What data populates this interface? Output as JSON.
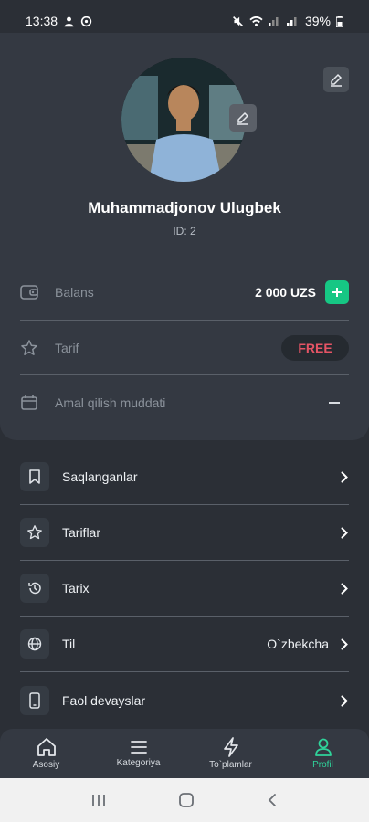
{
  "status_bar": {
    "time": "13:38",
    "battery": "39%"
  },
  "profile": {
    "name": "Muhammadjonov Ulugbek",
    "id_text": "ID: 2",
    "rows": [
      {
        "label": "Balans",
        "value": "2 000  UZS"
      },
      {
        "label": "Tarif",
        "value": "FREE"
      },
      {
        "label": "Amal qilish muddati",
        "value": ""
      }
    ]
  },
  "menu": [
    {
      "label": "Saqlanganlar",
      "icon": "bookmark-icon"
    },
    {
      "label": "Tariflar",
      "icon": "star-icon"
    },
    {
      "label": "Tarix",
      "icon": "history-icon"
    },
    {
      "label": "Til",
      "value": "O`zbekcha",
      "icon": "globe-icon"
    },
    {
      "label": "Faol devayslar",
      "icon": "phone-icon"
    }
  ],
  "bottom_nav": [
    {
      "label": "Asosiy",
      "icon": "home-icon"
    },
    {
      "label": "Kategoriya",
      "icon": "menu-icon"
    },
    {
      "label": "To`plamlar",
      "icon": "lightning-icon"
    },
    {
      "label": "Profil",
      "icon": "profile-icon",
      "active": true
    }
  ],
  "colors": {
    "accent": "#16c784",
    "active_nav": "#2fd39a",
    "free_badge": "#e55465",
    "background": "#2b2f36",
    "card": "#343942"
  }
}
